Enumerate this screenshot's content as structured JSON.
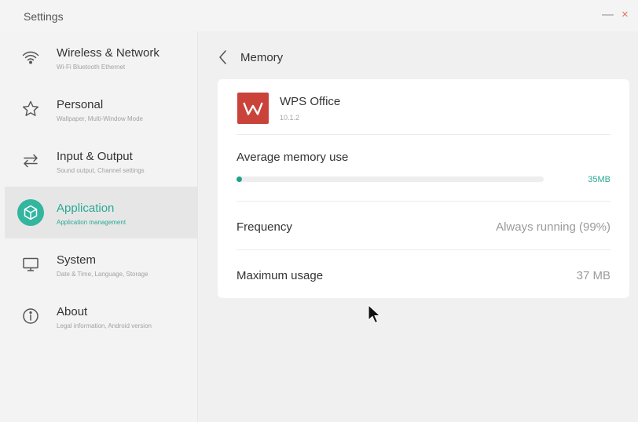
{
  "window": {
    "title": "Settings",
    "minimize_glyph": "—",
    "close_glyph": "×"
  },
  "sidebar": {
    "items": [
      {
        "label": "Wireless & Network",
        "sub": "Wi-Fi Bluetooth Ethernet",
        "icon": "wifi-icon"
      },
      {
        "label": "Personal",
        "sub": "Wallpaper, Multi-Window Mode",
        "icon": "star-icon"
      },
      {
        "label": "Input & Output",
        "sub": "Sound output, Channel settings",
        "icon": "swap-arrows-icon"
      },
      {
        "label": "Application",
        "sub": "Application management",
        "icon": "cube-icon",
        "active": true
      },
      {
        "label": "System",
        "sub": "Date & Time, Language, Storage",
        "icon": "monitor-icon"
      },
      {
        "label": "About",
        "sub": "Legal information, Android version",
        "icon": "info-icon"
      }
    ]
  },
  "header": {
    "title": "Memory"
  },
  "app": {
    "name": "WPS Office",
    "version": "10.1.2",
    "logo_letter": "W"
  },
  "memory": {
    "average_label": "Average memory use",
    "average_value": "35MB",
    "average_fraction": 0.01,
    "frequency_label": "Frequency",
    "frequency_value": "Always running (99%)",
    "max_label": "Maximum usage",
    "max_value": "37 MB"
  },
  "colors": {
    "accent": "#2aa994",
    "logo_red": "#c9433a"
  }
}
